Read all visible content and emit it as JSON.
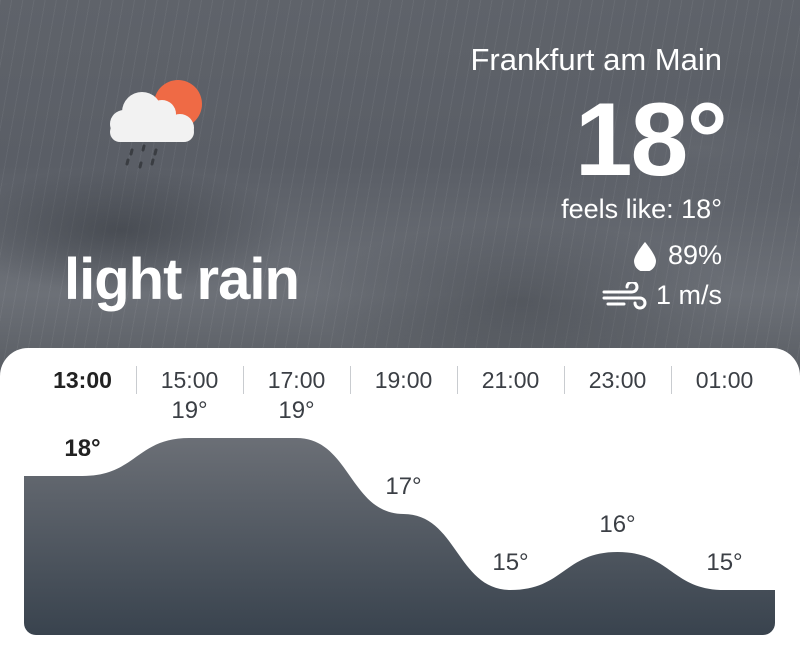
{
  "location": {
    "city": "Frankfurt am Main"
  },
  "current": {
    "temperature": "18°",
    "feels_like": "feels like: 18°",
    "humidity": "89%",
    "wind": "1 m/s",
    "condition": "light rain",
    "icon": "cloud-rain-sun-icon"
  },
  "colors": {
    "sun": "#ef6a45",
    "cloud": "#f2f2f2",
    "rain": "#3a3d42",
    "chart_top": "#6b6f76",
    "chart_bottom": "#39434e"
  },
  "hourly": [
    {
      "time": "13:00",
      "temp": "18°",
      "active": true
    },
    {
      "time": "15:00",
      "temp": "19°"
    },
    {
      "time": "17:00",
      "temp": "19°"
    },
    {
      "time": "19:00",
      "temp": "17°"
    },
    {
      "time": "21:00",
      "temp": "15°"
    },
    {
      "time": "23:00",
      "temp": "16°"
    },
    {
      "time": "01:00",
      "temp": "15°"
    }
  ],
  "chart_data": {
    "type": "area",
    "categories": [
      "13:00",
      "15:00",
      "17:00",
      "19:00",
      "21:00",
      "23:00",
      "01:00"
    ],
    "values": [
      18,
      19,
      19,
      17,
      15,
      16,
      15
    ]
  }
}
